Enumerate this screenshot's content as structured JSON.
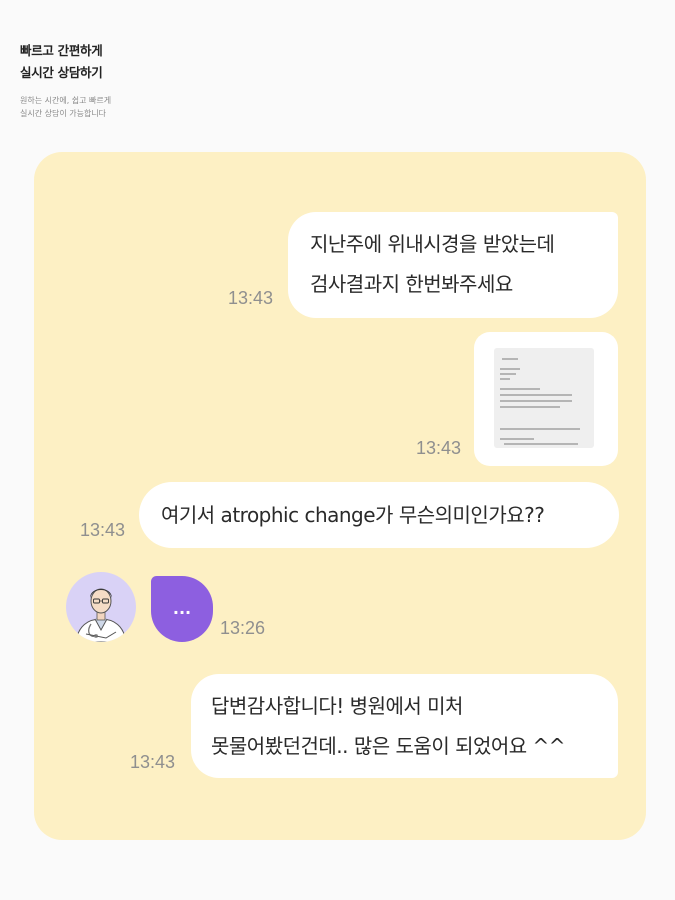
{
  "header": {
    "title_line1": "빠르고 간편하게",
    "title_line2": "실시간 상담하기",
    "sub_line1": "원하는 시간에, 쉽고 빠르게",
    "sub_line2": "실시간 상담이 가능합니다"
  },
  "chat": {
    "messages": [
      {
        "sender": "user",
        "line1": "지난주에 위내시경을 받았는데",
        "line2": "검사결과지 한번봐주세요",
        "time": "13:43"
      },
      {
        "sender": "user",
        "type": "image",
        "icon": "document-thumbnail",
        "time": "13:43"
      },
      {
        "sender": "user",
        "line1": "여기서  atrophic change가 무슨의미인가요??",
        "time": "13:43"
      },
      {
        "sender": "doctor",
        "type": "typing",
        "text": "...",
        "avatar_icon": "doctor-avatar-icon",
        "time": "13:26"
      },
      {
        "sender": "user",
        "line1": "답변감사합니다! 병원에서 미처",
        "line2": "못물어봤던건데.. 많은 도움이 되었어요 ^^",
        "time": "13:43"
      }
    ]
  },
  "colors": {
    "page_bg": "#fafafa",
    "panel_bg": "#fdf0c4",
    "bubble_bg": "#ffffff",
    "accent_purple": "#8d5fe0",
    "avatar_bg": "#d9d2f6",
    "time_text": "#8f8f8f"
  }
}
